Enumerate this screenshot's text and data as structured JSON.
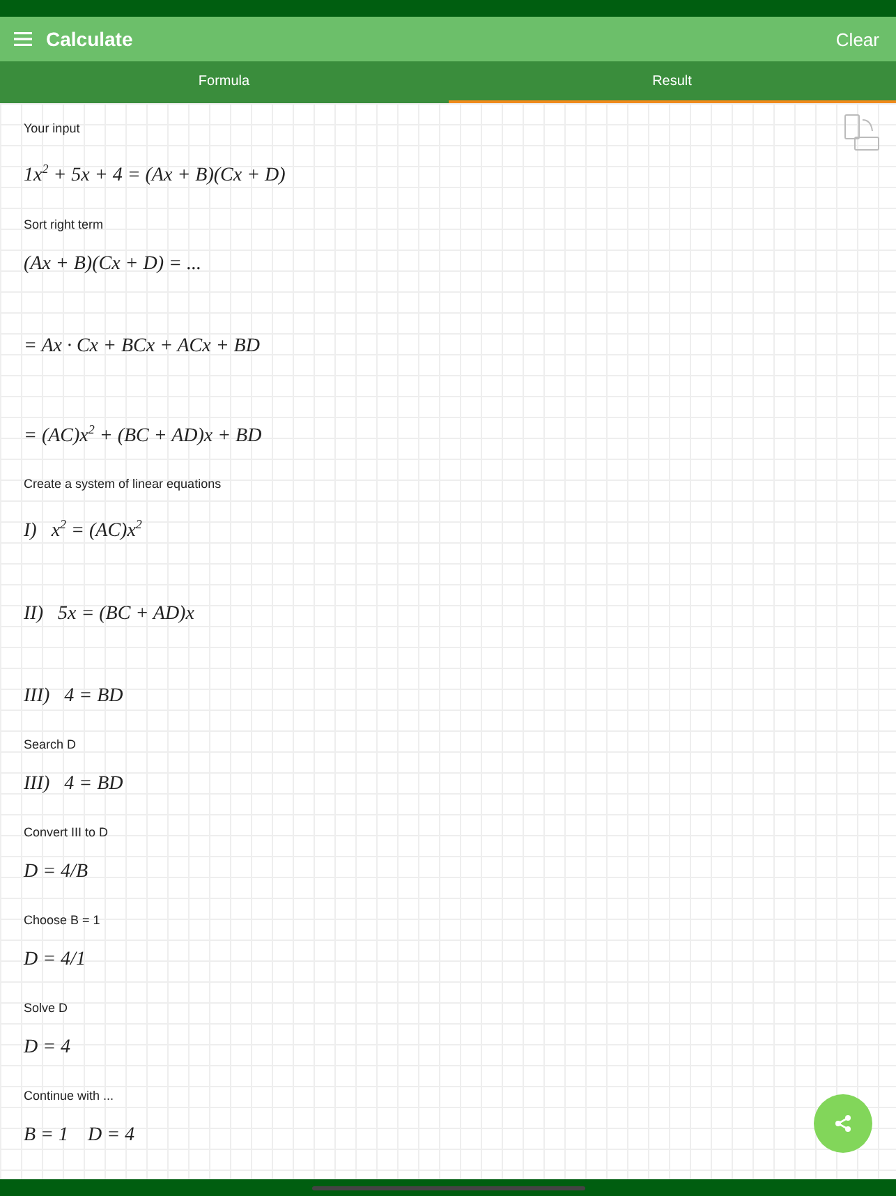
{
  "header": {
    "title": "Calculate",
    "action": "Clear"
  },
  "tabs": [
    {
      "label": "Formula",
      "selected": false
    },
    {
      "label": "Result",
      "selected": true
    }
  ],
  "steps": [
    {
      "kind": "label",
      "text": "Your input"
    },
    {
      "kind": "formula",
      "text": "1x$^{2}$ + 5x + 4 = (Ax + B)(Cx + D)"
    },
    {
      "kind": "label",
      "text": "Sort right term"
    },
    {
      "kind": "formula",
      "text": "(Ax + B)(Cx + D) = ..."
    },
    {
      "kind": "formula",
      "text": "= Ax · Cx + BCx + ACx + BD"
    },
    {
      "kind": "formula",
      "text": "= (AC)x$^{2}$ + (BC + AD)x + BD"
    },
    {
      "kind": "label",
      "text": "Create a system of linear equations"
    },
    {
      "kind": "formula",
      "text": "I)   x$^{2}$ = (AC)x$^{2}$"
    },
    {
      "kind": "formula",
      "text": "II)   5x = (BC + AD)x"
    },
    {
      "kind": "formula",
      "text": "III)   4 = BD"
    },
    {
      "kind": "label",
      "text": "Search D"
    },
    {
      "kind": "formula",
      "text": "III)   4 = BD"
    },
    {
      "kind": "label",
      "text": "Convert III to D"
    },
    {
      "kind": "formula",
      "text": "D = 4/B"
    },
    {
      "kind": "label",
      "text": "Choose B = 1"
    },
    {
      "kind": "formula",
      "text": "D = 4/1"
    },
    {
      "kind": "label",
      "text": "Solve D"
    },
    {
      "kind": "formula",
      "text": "D = 4"
    },
    {
      "kind": "label",
      "text": "Continue with ..."
    },
    {
      "kind": "formula",
      "text": "B = 1    D = 4"
    }
  ]
}
